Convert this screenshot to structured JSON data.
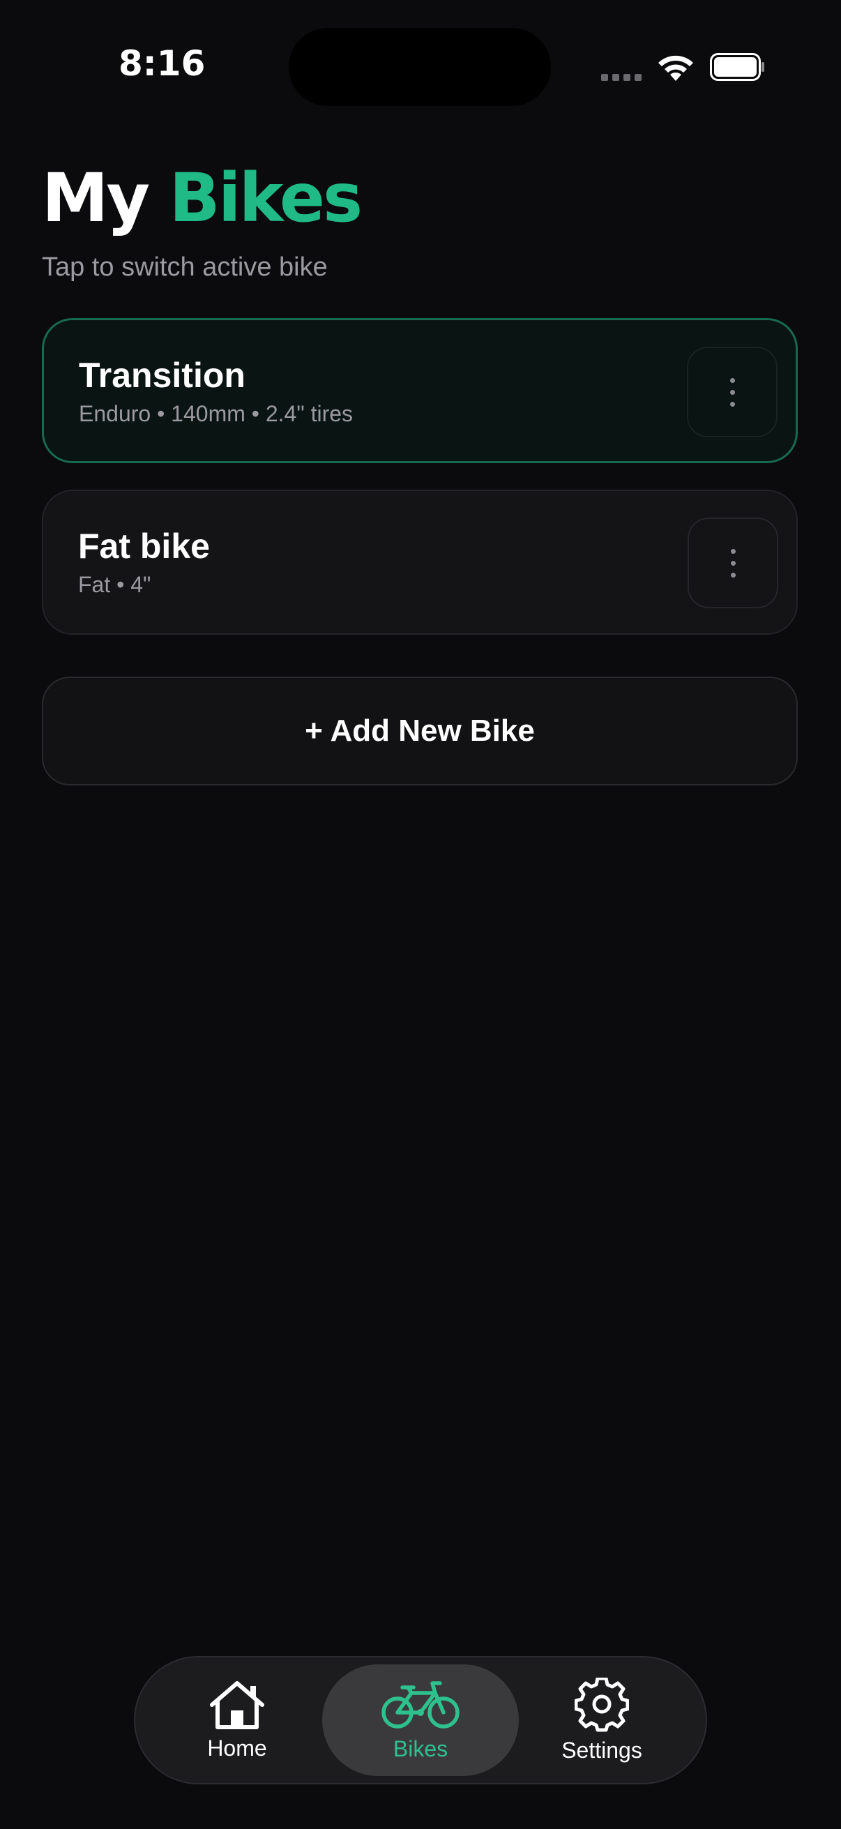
{
  "status_bar": {
    "time": "8:16"
  },
  "header": {
    "title_prefix": "My",
    "title_accent": "Bikes",
    "subtitle": "Tap to switch active bike"
  },
  "bikes": [
    {
      "name": "Transition",
      "details": "Enduro • 140mm • 2.4\" tires",
      "active": true
    },
    {
      "name": "Fat bike",
      "details": "Fat • 4\"",
      "active": false
    }
  ],
  "add_button": {
    "label": "+ Add New Bike"
  },
  "tabbar": {
    "tabs": [
      {
        "label": "Home",
        "icon": "home-icon",
        "selected": false
      },
      {
        "label": "Bikes",
        "icon": "bicycle-icon",
        "selected": true
      },
      {
        "label": "Settings",
        "icon": "gear-icon",
        "selected": false
      }
    ]
  },
  "colors": {
    "accent": "#1fba86",
    "background": "#0b0b0d",
    "card": "#141417",
    "active_border": "#176a4e",
    "muted_text": "#9a9aa0"
  }
}
